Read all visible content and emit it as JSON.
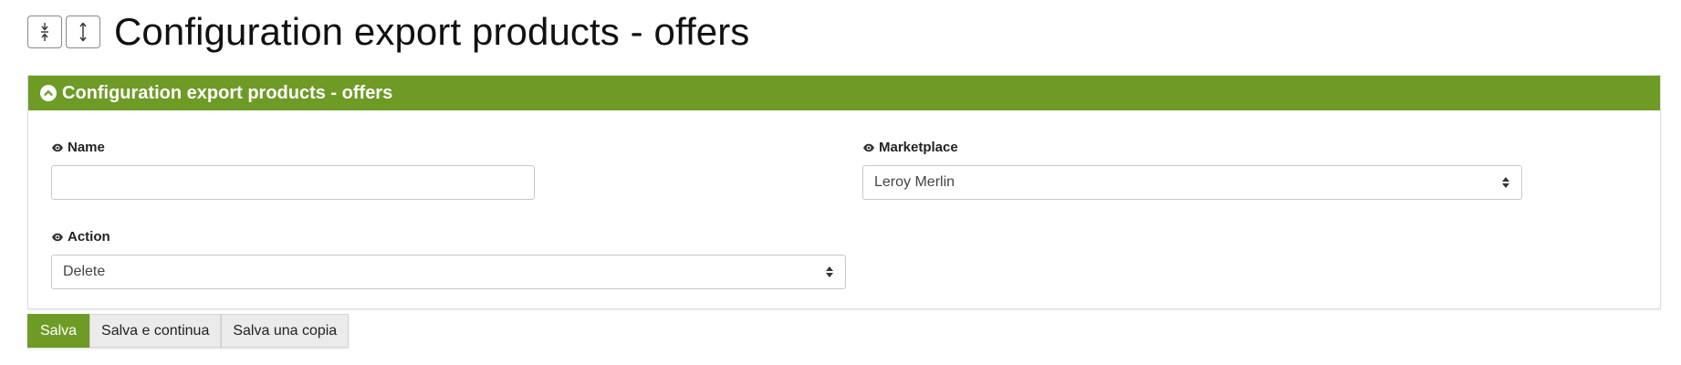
{
  "header": {
    "title": "Configuration export products - offers",
    "collapse_icon": "collapse-vertical-icon",
    "expand_icon": "expand-vertical-icon"
  },
  "panel": {
    "title": "Configuration export products - offers",
    "toggle_icon": "chevron-up-circle-icon",
    "accent_color": "#6e9b26"
  },
  "form": {
    "name": {
      "label": "Name",
      "value": "",
      "icon": "eye-icon"
    },
    "marketplace": {
      "label": "Marketplace",
      "value": "Leroy Merlin",
      "icon": "eye-icon"
    },
    "action": {
      "label": "Action",
      "value": "Delete",
      "icon": "eye-icon"
    }
  },
  "buttons": {
    "save": "Salva",
    "save_continue": "Salva e continua",
    "save_copy": "Salva una copia"
  }
}
